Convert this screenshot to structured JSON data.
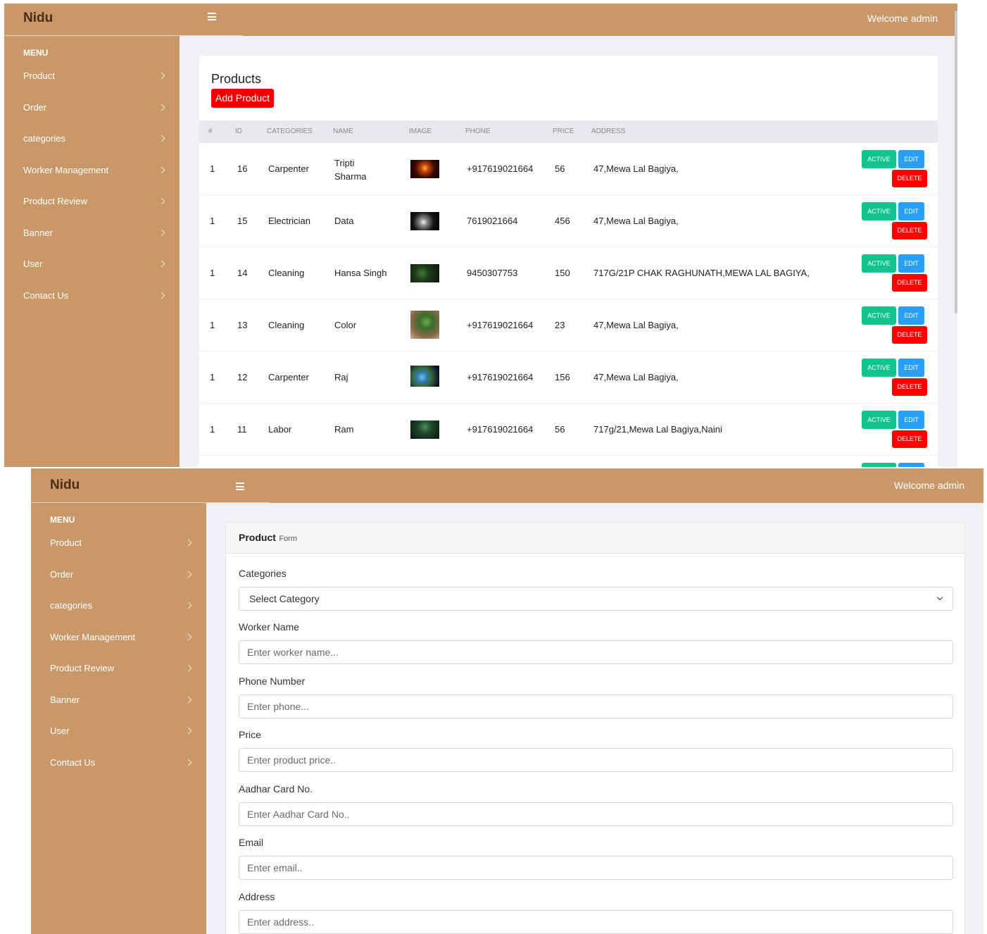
{
  "app": {
    "brand": "Nidu",
    "welcome": "Welcome admin"
  },
  "sidebar": {
    "title": "MENU",
    "items": [
      "Product",
      "Order",
      "categories",
      "Worker Management",
      "Product Review",
      "Banner",
      "User",
      "Contact Us"
    ]
  },
  "products": {
    "title": "Products",
    "add_label": "Add Product",
    "columns": [
      "#",
      "ID",
      "CATEGORIES",
      "NAME",
      "IMAGE",
      "PHONE",
      "PRICE",
      "ADDRESS"
    ],
    "rows": [
      {
        "num": "1",
        "id": "16",
        "category": "Carpenter",
        "name": "Tripti Sharma",
        "phone": "+917619021664",
        "price": "56",
        "address": "47,Mewa Lal Bagiya,"
      },
      {
        "num": "1",
        "id": "15",
        "category": "Electrician",
        "name": "Data",
        "phone": "7619021664",
        "price": "456",
        "address": "47,Mewa Lal Bagiya,"
      },
      {
        "num": "1",
        "id": "14",
        "category": "Cleaning",
        "name": "Hansa Singh",
        "phone": "9450307753",
        "price": "150",
        "address": "717G/21P CHAK RAGHUNATH,MEWA LAL BAGIYA,"
      },
      {
        "num": "1",
        "id": "13",
        "category": "Cleaning",
        "name": "Color",
        "phone": "+917619021664",
        "price": "23",
        "address": "47,Mewa Lal Bagiya,"
      },
      {
        "num": "1",
        "id": "12",
        "category": "Carpenter",
        "name": "Raj",
        "phone": "+917619021664",
        "price": "156",
        "address": "47,Mewa Lal Bagiya,"
      },
      {
        "num": "1",
        "id": "11",
        "category": "Labor",
        "name": "Ram",
        "phone": "+917619021664",
        "price": "56",
        "address": "717g/21,Mewa Lal Bagiya,Naini"
      }
    ],
    "actions": {
      "active": "ACTIVE",
      "edit": "EDIT",
      "delete": "DELETE"
    }
  },
  "form": {
    "title_bold": "Product",
    "title_small": "Form",
    "categories_label": "Categories",
    "categories_value": "Select Category",
    "worker_label": "Worker Name",
    "worker_placeholder": "Enter worker name...",
    "phone_label": "Phone Number",
    "phone_placeholder": "Enter phone...",
    "price_label": "Price",
    "price_placeholder": "Enter product price..",
    "aadhar_label": "Aadhar Card No.",
    "aadhar_placeholder": "Enter Aadhar Card No..",
    "email_label": "Email",
    "email_placeholder": "Enter email..",
    "address_label": "Address",
    "address_placeholder": "Enter address.."
  },
  "colors": {
    "brand": "#c99868",
    "danger": "#f20000",
    "success": "#12c38c",
    "info": "#2a9df4"
  }
}
